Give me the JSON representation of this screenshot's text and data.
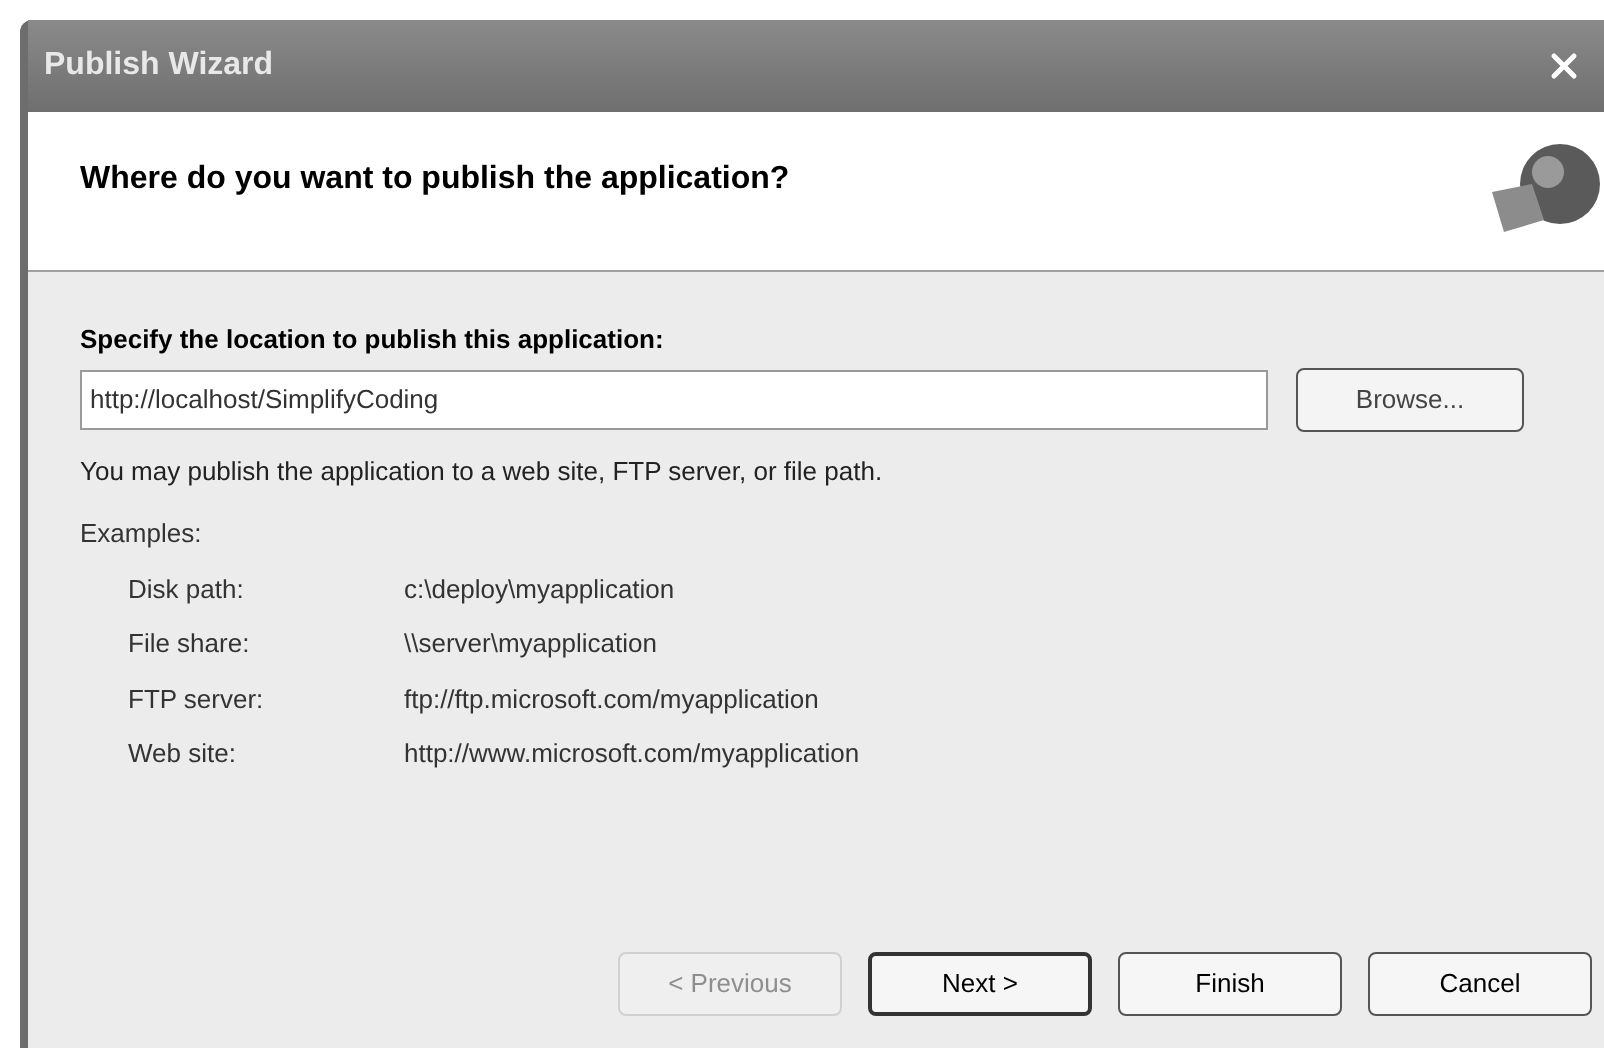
{
  "window": {
    "title": "Publish Wizard"
  },
  "header": {
    "title": "Where do you want to publish the application?"
  },
  "location": {
    "label": "Specify the location to publish this application:",
    "value": "http://localhost/SimplifyCoding",
    "browse": "Browse..."
  },
  "hint": "You may publish the application to a web site, FTP server, or file path.",
  "examples": {
    "label": "Examples:",
    "rows": [
      {
        "name": "Disk path:",
        "value": "c:\\deploy\\myapplication"
      },
      {
        "name": "File share:",
        "value": "\\\\server\\myapplication"
      },
      {
        "name": "FTP server:",
        "value": "ftp://ftp.microsoft.com/myapplication"
      },
      {
        "name": "Web site:",
        "value": "http://www.microsoft.com/myapplication"
      }
    ]
  },
  "buttons": [
    {
      "label": "< Previous",
      "disabled": true,
      "default": false
    },
    {
      "label": "Next >",
      "disabled": false,
      "default": true
    },
    {
      "label": "Finish",
      "disabled": false,
      "default": false
    },
    {
      "label": "Cancel",
      "disabled": false,
      "default": false
    }
  ]
}
